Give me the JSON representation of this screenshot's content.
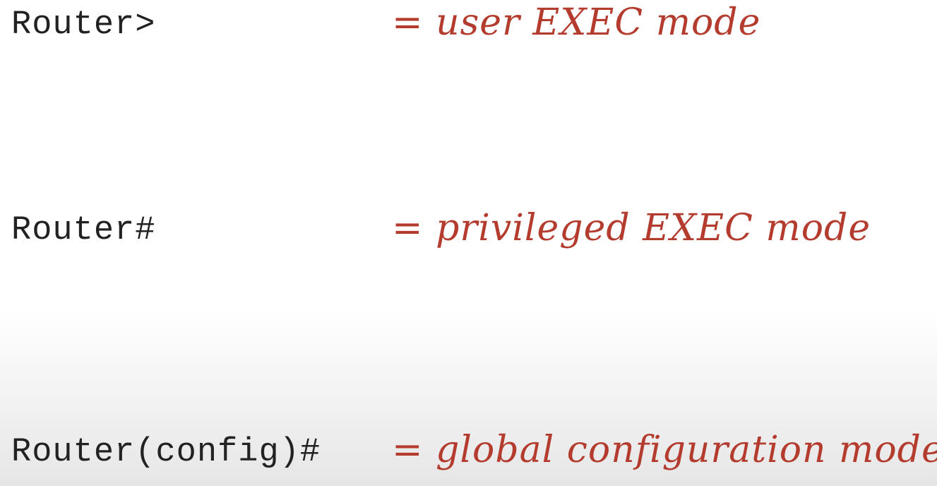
{
  "colors": {
    "prompt_text": "#222222",
    "meaning_text": "#b43c2e"
  },
  "modes": [
    {
      "prompt": "Router>",
      "meaning": "= user EXEC mode"
    },
    {
      "prompt": "Router#",
      "meaning": "= privileged EXEC mode"
    },
    {
      "prompt": "Router(config)#",
      "meaning": "= global configuration mode"
    }
  ]
}
